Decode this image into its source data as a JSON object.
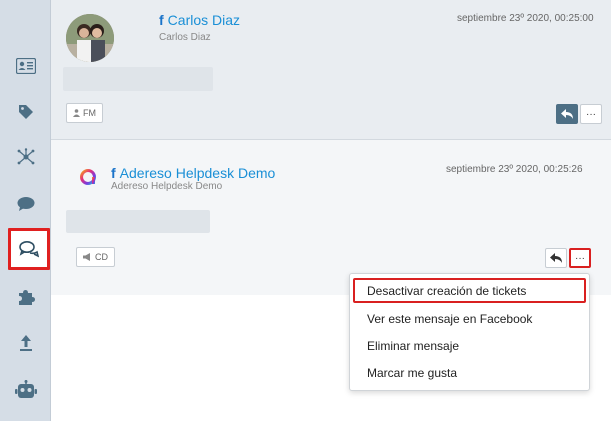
{
  "sidebar": {
    "items": [
      {
        "icon": "contact-card-icon"
      },
      {
        "icon": "tag-icon"
      },
      {
        "icon": "network-icon"
      },
      {
        "icon": "chat-bubble-icon"
      },
      {
        "icon": "conversations-icon",
        "active": true
      },
      {
        "icon": "puzzle-icon"
      },
      {
        "icon": "upload-arrow-icon"
      },
      {
        "icon": "robot-icon"
      }
    ]
  },
  "messages": [
    {
      "author_name": "Carlos Diaz",
      "author_handle": "Carlos Diaz",
      "date": "septiembre 23º 2020, 00:25:00",
      "tag_label": "FM"
    },
    {
      "author_name": "Adereso Helpdesk Demo",
      "author_handle": "Adereso Helpdesk Demo",
      "date": "septiembre 23º 2020, 00:25:26",
      "tag_label": "CD"
    }
  ],
  "more_label": "···",
  "menu": {
    "items": [
      "Desactivar creación de tickets",
      "Ver este mensaje en Facebook",
      "Eliminar mensaje",
      "Marcar me gusta"
    ]
  },
  "colors": {
    "accent": "#1a8fd6",
    "highlight": "#d92020",
    "reply_button_active": "#4d6f85"
  }
}
